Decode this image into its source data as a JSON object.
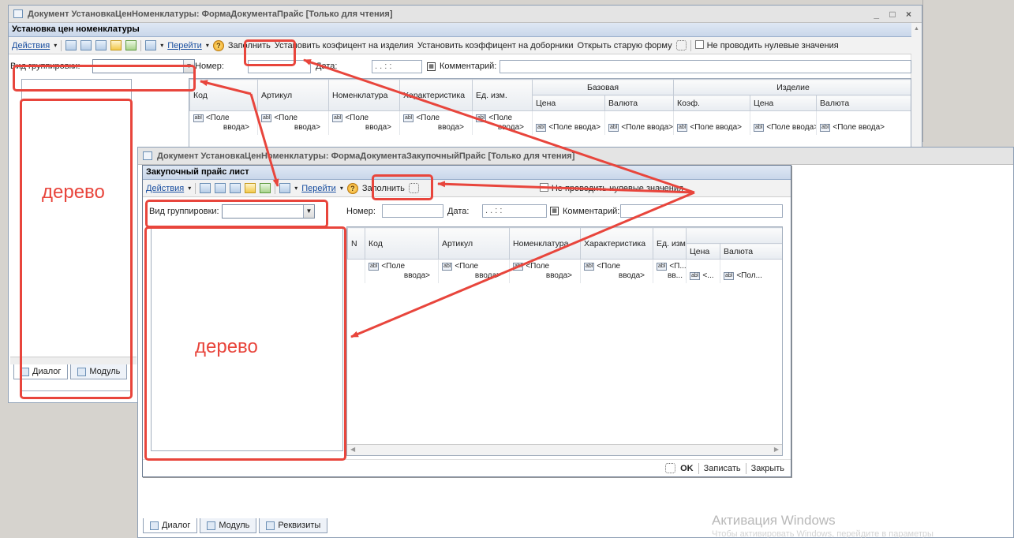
{
  "back_window": {
    "title": "Документ УстановкаЦенНоменклатуры: ФормаДокументаПрайс [Только для чтения]",
    "window_controls": "_ □ ×",
    "form_header": "Установка цен номенклатуры",
    "toolbar": {
      "actions": "Действия",
      "goto": "Перейти",
      "fill": "Заполнить",
      "set_coef_products": "Установить коэфицент на изделия",
      "set_coef_additions": "Установить коэффицент на доборники",
      "open_old_form": "Открыть старую форму",
      "no_zero_values": "Не проводить нулевые значения"
    },
    "grouping_label": "Вид группировки:",
    "number_label": "Номер:",
    "date_label": "Дата:",
    "date_value": ". .   : :",
    "comment_label": "Комментарий:",
    "columns": {
      "code": "Код",
      "article": "Артикул",
      "nomenclature": "Номенклатура",
      "characteristic": "Характеристика",
      "unit": "Ед. изм.",
      "base": "Базовая",
      "product": "Изделие",
      "price": "Цена",
      "currency": "Валюта",
      "coef": "Коэф.",
      "price2": "Цена",
      "currency2": "Валюта"
    },
    "field_placeholder_a": "<Поле",
    "field_placeholder_b": "ввода>",
    "field_placeholder_full": "<Поле ввода>",
    "bottom_tabs": [
      "Диалог",
      "Модуль"
    ]
  },
  "front_window": {
    "title": "Документ УстановкаЦенНоменклатуры: ФормаДокументаЗакупочныйПрайс [Только для чтения]",
    "form_header": "Закупочный прайс лист",
    "toolbar": {
      "actions": "Действия",
      "goto": "Перейти",
      "fill": "Заполнить",
      "no_zero_values": "Не проводить нулевые значения"
    },
    "grouping_label": "Вид группировки:",
    "number_label": "Номер:",
    "date_label": "Дата:",
    "date_value": ". .   : :",
    "comment_label": "Комментарий:",
    "columns": {
      "n": "N",
      "code": "Код",
      "article": "Артикул",
      "nomenclature": "Номенклатура",
      "characteristic": "Характеристика",
      "unit": "Ед. изм.",
      "price": "Цена",
      "currency": "Валюта"
    },
    "field_placeholder_a": "<Поле",
    "field_placeholder_b": "ввода>",
    "unit_field_a": "<П...",
    "unit_field_b": "вв...",
    "price_field": "<...",
    "currency_field": "<Пол...",
    "buttons": {
      "ok": "OK",
      "save": "Записать",
      "close": "Закрыть"
    },
    "bottom_tabs": [
      "Диалог",
      "Модуль",
      "Реквизиты"
    ]
  },
  "annotations": {
    "tree_label_1": "дерево",
    "tree_label_2": "дерево",
    "color": "#e8453c"
  },
  "watermark": {
    "line1": "Активация Windows",
    "line2": "Чтобы активировать Windows, перейдите в параметры"
  }
}
